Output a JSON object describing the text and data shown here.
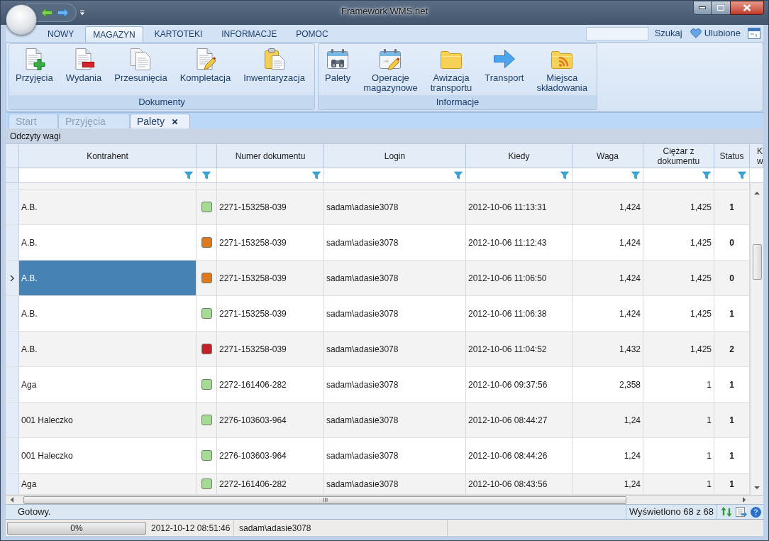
{
  "window": {
    "title": "Framework WMS.net"
  },
  "ribbon": {
    "tabs": [
      {
        "label": "NOWY",
        "selected": false
      },
      {
        "label": "MAGAZYN",
        "selected": true
      },
      {
        "label": "KARTOTEKI",
        "selected": false
      },
      {
        "label": "INFORMACJE",
        "selected": false
      },
      {
        "label": "POMOC",
        "selected": false
      }
    ],
    "search_button": "Szukaj",
    "favorites": "Ulubione",
    "groups": [
      {
        "label": "Dokumenty",
        "buttons": [
          "Przyjęcia",
          "Wydania",
          "Przesunięcia",
          "Kompletacja",
          "Inwentaryzacja"
        ]
      },
      {
        "label": "Informacje",
        "buttons": [
          "Palety",
          "Operacje magazynowe",
          "Awizacja transportu",
          "Transport",
          "Miejsca składowania"
        ]
      }
    ]
  },
  "document_tabs": [
    {
      "label": "Start",
      "selected": false,
      "closable": false
    },
    {
      "label": "Przyjęcia",
      "selected": false,
      "closable": false
    },
    {
      "label": "Palety",
      "selected": true,
      "closable": true
    }
  ],
  "panel": {
    "title": "Odczyty wagi"
  },
  "grid": {
    "columns": [
      {
        "kind": "text",
        "label": "Kontrahent",
        "filter": true
      },
      {
        "kind": "color",
        "filter": true
      },
      {
        "kind": "text",
        "label": "Numer dokumentu",
        "filter": true
      },
      {
        "kind": "text",
        "label": "Login",
        "filter": true
      },
      {
        "kind": "text",
        "label": "Kiedy",
        "filter": true
      },
      {
        "kind": "text",
        "label": "Waga",
        "filter": true
      },
      {
        "kind": "text",
        "label": "Ciężar z dokumentu",
        "filter": true
      },
      {
        "kind": "text",
        "label": "Status",
        "filter": true
      },
      {
        "kind": "text",
        "label": "K w",
        "filter": false
      }
    ],
    "rows": [
      {
        "selected": false,
        "cells": [
          "A.B.",
          {
            "color": "#a4dc94"
          },
          "2271-153258-039",
          "sadam\\adasie3078",
          "2012-10-06 11:13:31",
          "1,424",
          "1,425",
          "1"
        ]
      },
      {
        "selected": false,
        "cells": [
          "A.B.",
          {
            "color": "#e0781c"
          },
          "2271-153258-039",
          "sadam\\adasie3078",
          "2012-10-06 11:12:43",
          "1,424",
          "1,425",
          "0"
        ]
      },
      {
        "selected": true,
        "cells": [
          "A.B.",
          {
            "color": "#e0781c"
          },
          "2271-153258-039",
          "sadam\\adasie3078",
          "2012-10-06 11:06:50",
          "1,424",
          "1,425",
          "0"
        ]
      },
      {
        "selected": false,
        "cells": [
          "A.B.",
          {
            "color": "#a4dc94"
          },
          "2271-153258-039",
          "sadam\\adasie3078",
          "2012-10-06 11:06:38",
          "1,424",
          "1,425",
          "1"
        ]
      },
      {
        "selected": false,
        "cells": [
          "A.B.",
          {
            "color": "#c81e2a"
          },
          "2271-153258-039",
          "sadam\\adasie3078",
          "2012-10-06 11:04:52",
          "1,432",
          "1,425",
          "2"
        ]
      },
      {
        "selected": false,
        "cells": [
          "Aga",
          {
            "color": "#a4dc94"
          },
          "2272-161406-282",
          "sadam\\adasie3078",
          "2012-10-06 09:37:56",
          "2,358",
          "1",
          "1"
        ]
      },
      {
        "selected": false,
        "cells": [
          "001 Haleczko",
          {
            "color": "#a4dc94"
          },
          "2276-103603-964",
          "sadam\\adasie3078",
          "2012-10-06 08:44:27",
          "1,24",
          "1",
          "1"
        ]
      },
      {
        "selected": false,
        "cells": [
          "001 Haleczko",
          {
            "color": "#a4dc94"
          },
          "2276-103603-964",
          "sadam\\adasie3078",
          "2012-10-06 08:44:26",
          "1,24",
          "1",
          "1"
        ]
      },
      {
        "selected": false,
        "cells": [
          "Aga",
          {
            "color": "#a4dc94"
          },
          "2272-161406-282",
          "sadam\\adasie3078",
          "2012-10-06 08:43:56",
          "1,24",
          "1",
          "1"
        ]
      }
    ]
  },
  "status_bar": {
    "message": "Gotowy.",
    "record_count": "Wyświetlono 68 z 68"
  },
  "footer": {
    "progress": {
      "level": 0,
      "label": "0%"
    },
    "datetime": "2012-10-12 08:51:46",
    "user": "sadam\\adasie3078"
  }
}
